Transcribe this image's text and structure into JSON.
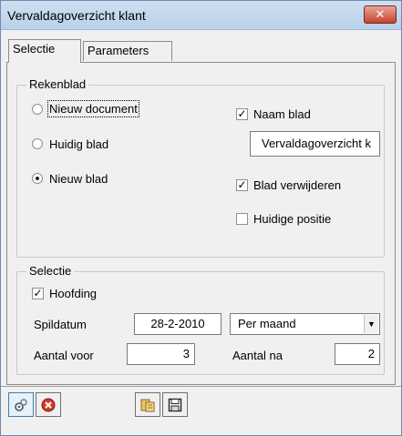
{
  "window": {
    "title": "Vervaldagoverzicht klant",
    "close_label": "✕"
  },
  "tabs": [
    {
      "label": "Selectie",
      "active": true
    },
    {
      "label": "Parameters",
      "active": false
    }
  ],
  "rekenblad": {
    "legend": "Rekenblad",
    "options": [
      {
        "label": "Nieuw document",
        "checked": false
      },
      {
        "label": "Huidig blad",
        "checked": false
      },
      {
        "label": "Nieuw blad",
        "checked": true
      }
    ],
    "naam_blad": {
      "label": "Naam blad",
      "checked": true
    },
    "naam_blad_value": "Vervaldagoverzicht k",
    "blad_verwijderen": {
      "label": "Blad verwijderen",
      "checked": true
    },
    "huidige_positie": {
      "label": "Huidige positie",
      "checked": false
    }
  },
  "selectie": {
    "legend": "Selectie",
    "hoofding": {
      "label": "Hoofding",
      "checked": true
    },
    "spildatum_label": "Spildatum",
    "spildatum_value": "28-2-2010",
    "periode_value": "Per maand",
    "aantal_voor_label": "Aantal voor",
    "aantal_voor_value": "3",
    "aantal_na_label": "Aantal na",
    "aantal_na_value": "2"
  },
  "toolbar": {
    "buttons": [
      "run-icon",
      "cancel-icon",
      "open-icon",
      "save-icon"
    ]
  }
}
